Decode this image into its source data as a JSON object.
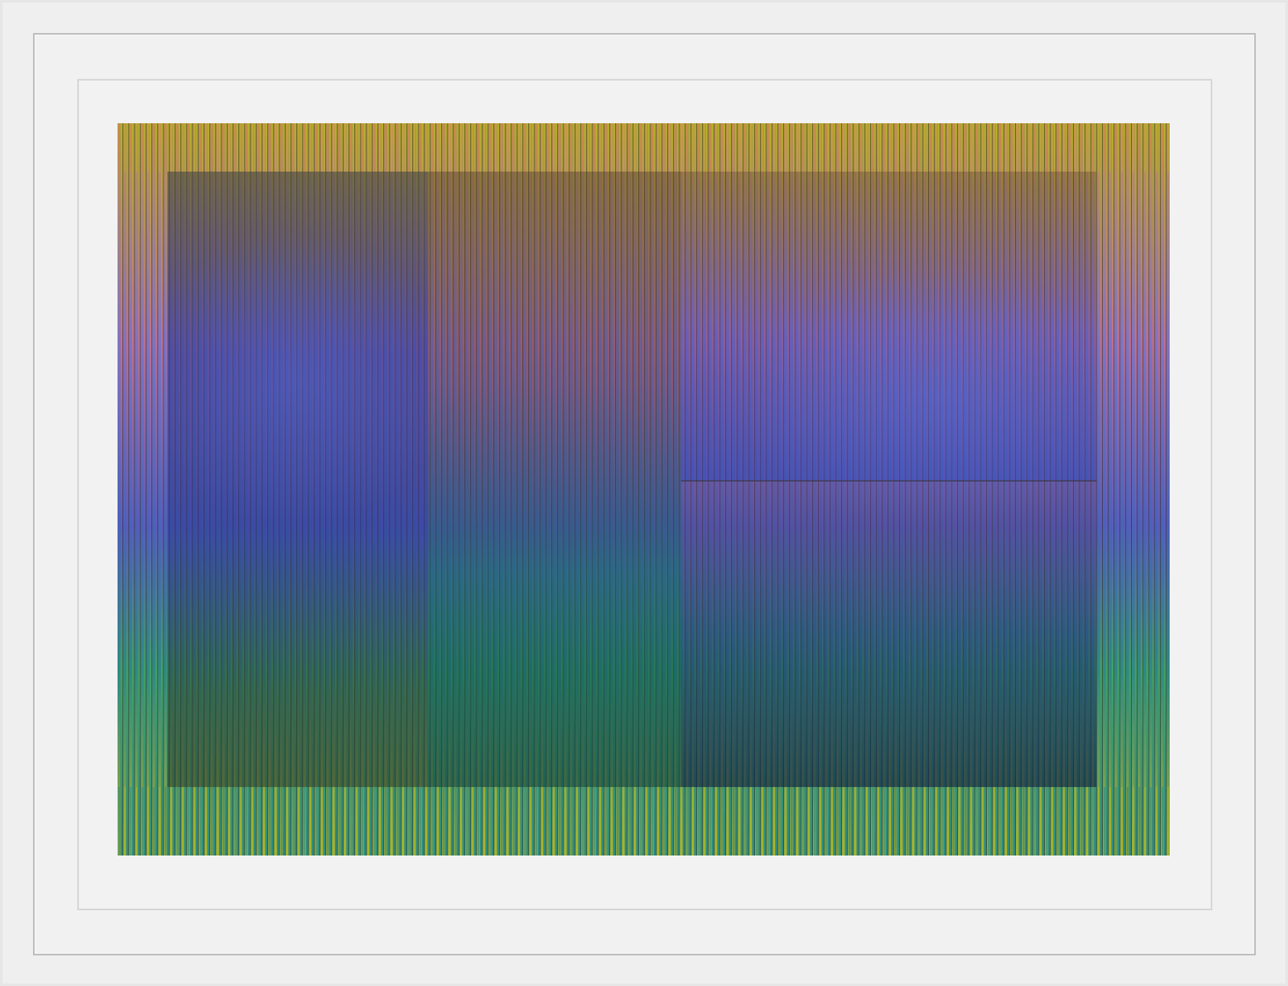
{
  "artwork": {
    "palette": {
      "yellow": "#b8b22a",
      "orange": "#c9884a",
      "pink": "#c0708c",
      "violet": "#7e6fc8",
      "blue": "#4d5fc4",
      "navy": "#20285e",
      "teal": "#2e8f86",
      "green": "#4ba560",
      "lime": "#a5b62c",
      "dark": "#2b2a20"
    },
    "frame_colors": {
      "outer": "#efefef",
      "inner_border": "#bdbdbd",
      "mat": "#f2f2f2"
    }
  }
}
